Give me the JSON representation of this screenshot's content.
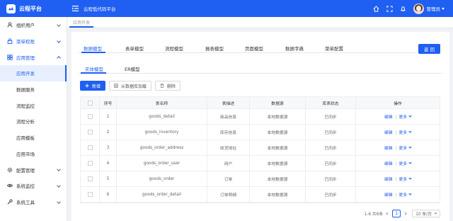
{
  "header": {
    "logo_text": "云程平台",
    "title": "云程低代码平台",
    "user_name": "管理员"
  },
  "sidebar": {
    "items": [
      {
        "label": "组织用户",
        "icon": "user-icon",
        "state": "collapsed"
      },
      {
        "label": "菜单权限",
        "icon": "lock-icon",
        "state": "collapsed"
      },
      {
        "label": "应用管理",
        "icon": "app-icon",
        "state": "expanded"
      },
      {
        "label": "配置管理",
        "icon": "gear-icon",
        "state": "collapsed"
      },
      {
        "label": "系统监控",
        "icon": "eye-icon",
        "state": "collapsed"
      },
      {
        "label": "系统工具",
        "icon": "wrench-icon",
        "state": "collapsed"
      }
    ],
    "app_sub": [
      {
        "label": "应用开发",
        "active": true
      },
      {
        "label": "数据服务",
        "active": false
      },
      {
        "label": "流程监控",
        "active": false
      },
      {
        "label": "流程分析",
        "active": false
      },
      {
        "label": "应用模板",
        "active": false
      },
      {
        "label": "应用市场",
        "active": false
      }
    ]
  },
  "page_tab": "应用开发",
  "tabs1": [
    "数据模型",
    "表单模型",
    "流程模型",
    "报表模型",
    "页面模型",
    "数据字典",
    "菜单配置"
  ],
  "back_label": "返 回",
  "tabs2": [
    "实体模型",
    "ER模型"
  ],
  "toolbar": {
    "add": "新增",
    "load": "从数据库加载",
    "delete": "删除"
  },
  "table": {
    "headers": [
      "序号",
      "表名称",
      "表描述",
      "数据源",
      "库表状态",
      "操作"
    ],
    "rows": [
      {
        "no": "1",
        "name": "goods_detail",
        "desc": "商品信息",
        "source": "本地数据源",
        "status": "已同步"
      },
      {
        "no": "2",
        "name": "goods_inventory",
        "desc": "库存信息",
        "source": "本地数据源",
        "status": "已同步"
      },
      {
        "no": "3",
        "name": "goods_order_address",
        "desc": "收货地址",
        "source": "本地数据源",
        "status": "已同步"
      },
      {
        "no": "4",
        "name": "goods_order_user",
        "desc": "用户",
        "source": "本地数据源",
        "status": "已同步"
      },
      {
        "no": "5",
        "name": "goods_order",
        "desc": "订单",
        "source": "本地数据源",
        "status": "已同步"
      },
      {
        "no": "6",
        "name": "goods_order_detail",
        "desc": "订单明细",
        "source": "本地数据源",
        "status": "已同步"
      }
    ],
    "op_edit": "编辑",
    "op_more": "更多"
  },
  "pager": {
    "summary": "1-6 共6条",
    "current": "1",
    "page_size": "10 条/页"
  },
  "colors": {
    "primary": "#1f5ff2",
    "background": "#f0f2f5"
  }
}
